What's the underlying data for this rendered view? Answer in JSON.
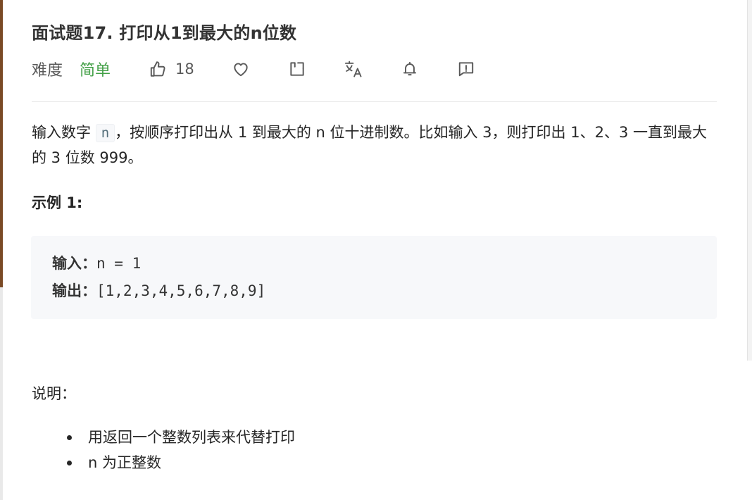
{
  "problem": {
    "title": "面试题17. 打印从1到最大的n位数",
    "difficulty_label": "难度",
    "difficulty_value": "简单",
    "difficulty_color": "#43a047",
    "likes": "18",
    "icons": [
      "thumbs-up-icon",
      "heart-icon",
      "share-icon",
      "translate-icon",
      "bell-icon",
      "feedback-icon"
    ]
  },
  "description": {
    "part1": "输入数字",
    "inline_code": "n",
    "part2": "，按顺序打印出从 1 到最大的 n 位十进制数。比如输入 3，则打印出 1、2、3 一直到最大的 3 位数 999。"
  },
  "example": {
    "title": "示例 1:",
    "input_label": "输入：",
    "input_value": "n = 1",
    "output_label": "输出：",
    "output_value": "[1,2,3,4,5,6,7,8,9]"
  },
  "notes": {
    "title": "说明：",
    "items": [
      "用返回一个整数列表来代替打印",
      "n 为正整数"
    ]
  }
}
